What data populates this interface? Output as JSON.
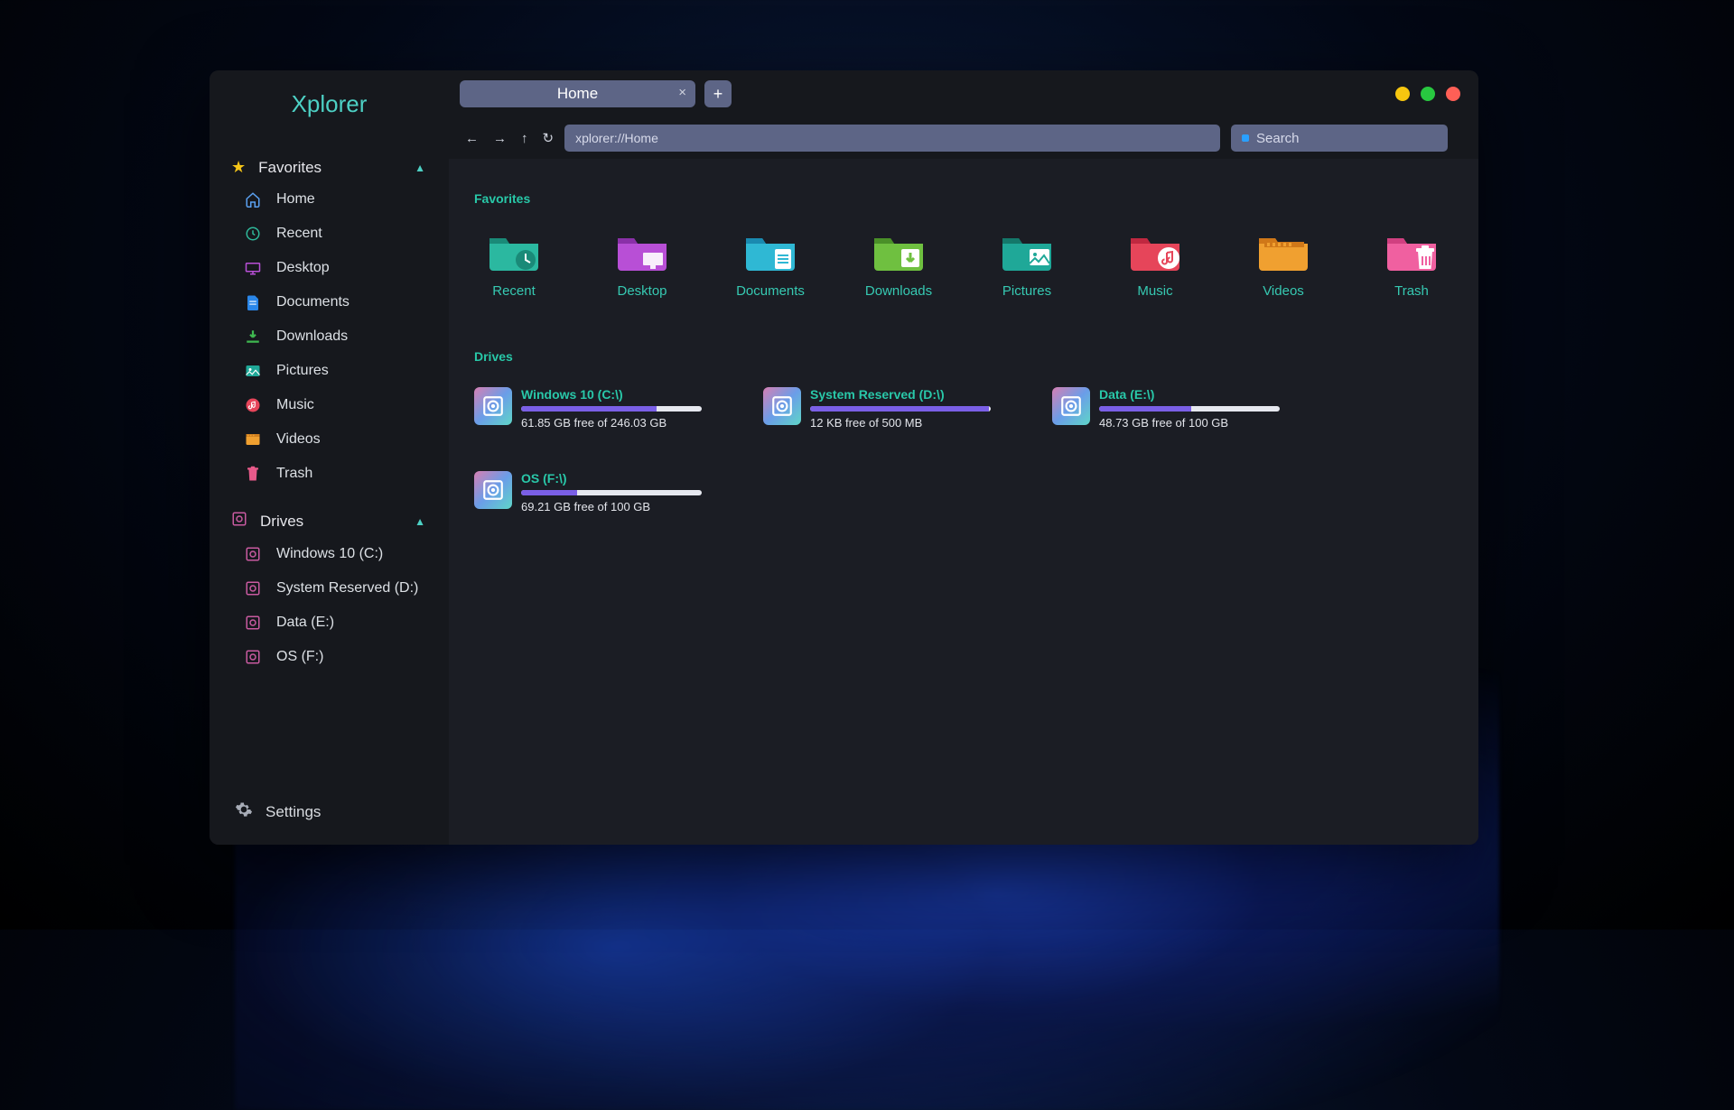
{
  "app": {
    "title": "Xplorer"
  },
  "titlebar": {
    "tab_label": "Home",
    "newtab_glyph": "+",
    "close_glyph": "×"
  },
  "navbar": {
    "address": "xplorer://Home",
    "search_placeholder": "Search"
  },
  "sidebar": {
    "favorites_header": "Favorites",
    "drives_header": "Drives",
    "items": [
      {
        "label": "Home"
      },
      {
        "label": "Recent"
      },
      {
        "label": "Desktop"
      },
      {
        "label": "Documents"
      },
      {
        "label": "Downloads"
      },
      {
        "label": "Pictures"
      },
      {
        "label": "Music"
      },
      {
        "label": "Videos"
      },
      {
        "label": "Trash"
      }
    ],
    "drives": [
      {
        "label": "Windows 10 (C:)"
      },
      {
        "label": "System Reserved (D:)"
      },
      {
        "label": "Data (E:)"
      },
      {
        "label": "OS (F:)"
      }
    ],
    "settings_label": "Settings"
  },
  "content": {
    "favorites_heading": "Favorites",
    "drives_heading": "Drives",
    "favorites": [
      {
        "label": "Recent"
      },
      {
        "label": "Desktop"
      },
      {
        "label": "Documents"
      },
      {
        "label": "Downloads"
      },
      {
        "label": "Pictures"
      },
      {
        "label": "Music"
      },
      {
        "label": "Videos"
      },
      {
        "label": "Trash"
      }
    ],
    "drives": [
      {
        "name": "Windows 10 (C:\\)",
        "free": "61.85 GB free of 246.03 GB",
        "pct": 75
      },
      {
        "name": "System Reserved (D:\\)",
        "free": "12 KB free of 500 MB",
        "pct": 99
      },
      {
        "name": "Data (E:\\)",
        "free": "48.73 GB free of 100 GB",
        "pct": 51
      },
      {
        "name": "OS (F:\\)",
        "free": "69.21 GB free of 100 GB",
        "pct": 31
      }
    ]
  }
}
